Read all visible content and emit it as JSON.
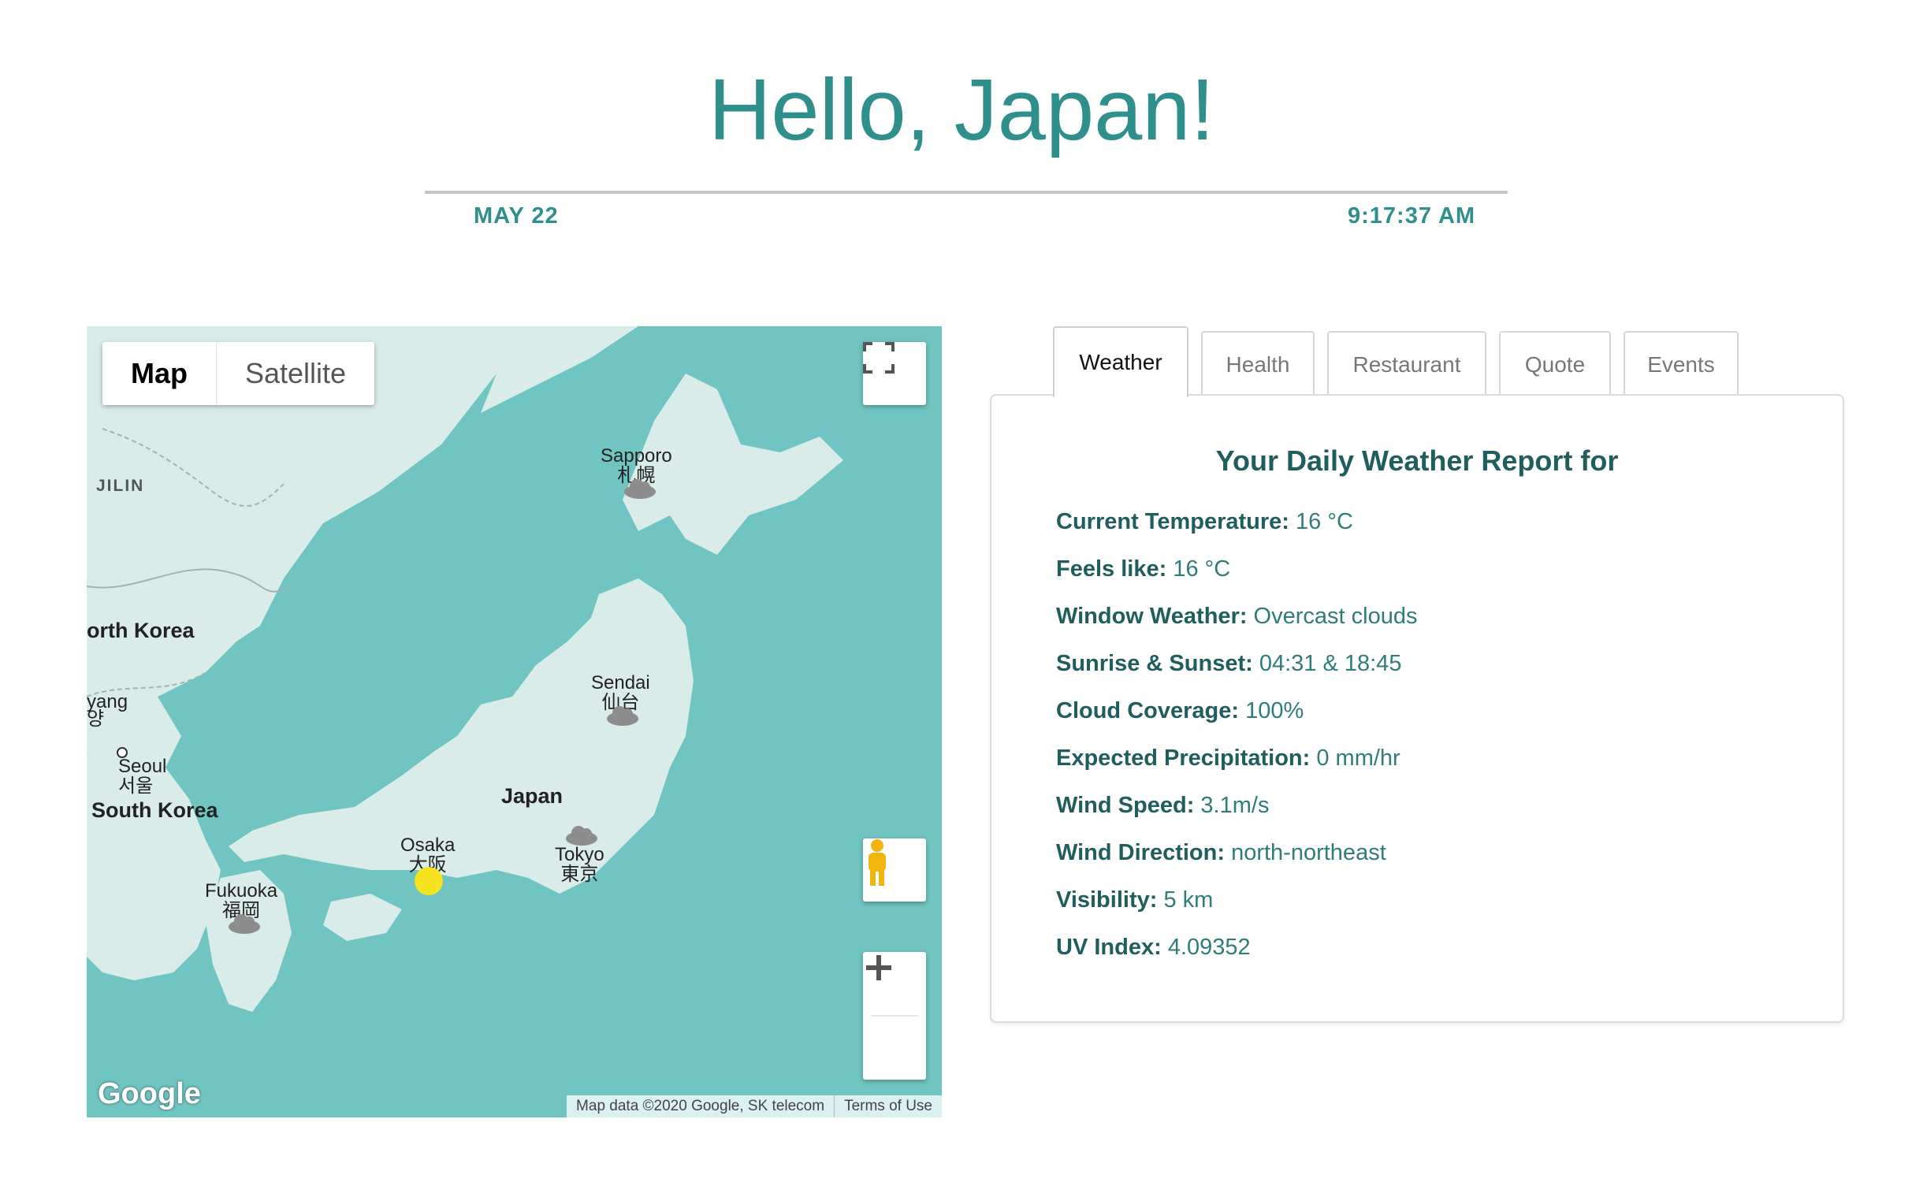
{
  "header": {
    "title": "Hello, Japan!",
    "date": "MAY 22",
    "time": "9:17:37 AM"
  },
  "map": {
    "type_options": [
      "Map",
      "Satellite"
    ],
    "selected_type": "Map",
    "labels": {
      "jilin": "JILIN",
      "north_korea": "orth Korea",
      "pyongyang": "yang",
      "pyongyang_local": "양",
      "seoul": "Seoul",
      "seoul_local": "서울",
      "south_korea": "South Korea",
      "japan": "Japan",
      "sapporo": "Sapporo",
      "sapporo_local": "札幌",
      "sendai": "Sendai",
      "sendai_local": "仙台",
      "osaka": "Osaka",
      "osaka_local": "大阪",
      "tokyo": "Tokyo",
      "tokyo_local": "東京",
      "fukuoka": "Fukuoka",
      "fukuoka_local": "福岡"
    },
    "google_logo": "Google",
    "attribution": "Map data ©2020 Google, SK telecom",
    "terms": "Terms of Use",
    "icons": {
      "fullscreen": "fullscreen-icon",
      "pegman": "pegman-icon",
      "zoom_in": "plus-icon",
      "zoom_out": "minus-icon",
      "weather": "cloud-icon",
      "marker": "location-dot-icon"
    },
    "colors": {
      "water": "#70c4c1",
      "land": "#d9ecea",
      "marker": "#f6e21e"
    }
  },
  "tabs": [
    {
      "label": "Weather",
      "active": true
    },
    {
      "label": "Health"
    },
    {
      "label": "Restaurant"
    },
    {
      "label": "Quote"
    },
    {
      "label": "Events"
    }
  ],
  "weather": {
    "title": "Your Daily Weather Report for",
    "rows": [
      {
        "label": "Current Temperature:",
        "value": "16 °C"
      },
      {
        "label": "Feels like:",
        "value": "16 °C"
      },
      {
        "label": "Window Weather:",
        "value": "Overcast clouds"
      },
      {
        "label": "Sunrise & Sunset:",
        "value": "04:31 & 18:45"
      },
      {
        "label": "Cloud Coverage:",
        "value": "100%"
      },
      {
        "label": "Expected Precipitation:",
        "value": "0 mm/hr"
      },
      {
        "label": "Wind Speed:",
        "value": "3.1m/s"
      },
      {
        "label": "Wind Direction:",
        "value": "north-northeast"
      },
      {
        "label": "Visibility:",
        "value": "5 km"
      },
      {
        "label": "UV Index:",
        "value": "4.09352"
      }
    ]
  }
}
